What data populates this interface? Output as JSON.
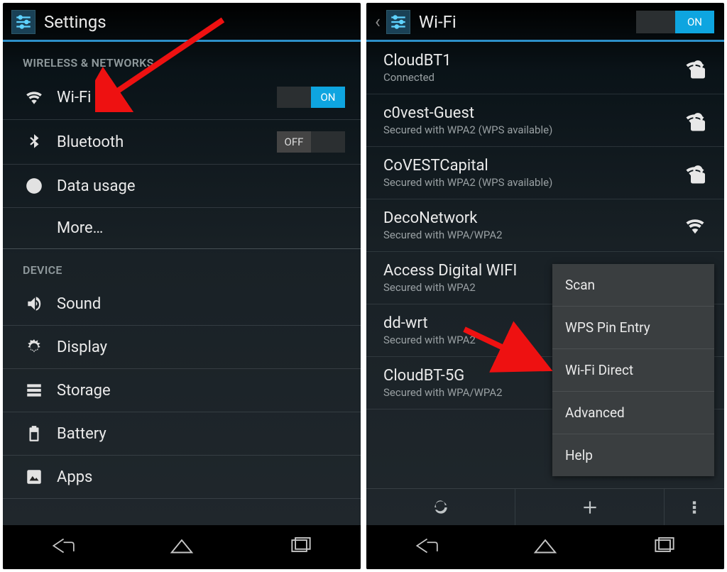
{
  "left": {
    "title": "Settings",
    "sections": {
      "wireless_label": "WIRELESS & NETWORKS",
      "device_label": "DEVICE"
    },
    "rows": {
      "wifi": {
        "label": "Wi-Fi",
        "toggle_on": "ON"
      },
      "bluetooth": {
        "label": "Bluetooth",
        "toggle_off": "OFF"
      },
      "data_usage": {
        "label": "Data usage"
      },
      "more": {
        "label": "More…"
      },
      "sound": {
        "label": "Sound"
      },
      "display": {
        "label": "Display"
      },
      "storage": {
        "label": "Storage"
      },
      "battery": {
        "label": "Battery"
      },
      "apps": {
        "label": "Apps"
      }
    }
  },
  "right": {
    "title": "Wi-Fi",
    "toggle_on": "ON",
    "networks": [
      {
        "ssid": "CloudBT1",
        "sub": "Connected",
        "secured": true
      },
      {
        "ssid": "c0vest-Guest",
        "sub": "Secured with WPA2 (WPS available)",
        "secured": true
      },
      {
        "ssid": "CoVESTCapital",
        "sub": "Secured with WPA2 (WPS available)",
        "secured": true
      },
      {
        "ssid": "DecoNetwork",
        "sub": "Secured with WPA/WPA2",
        "secured": true
      },
      {
        "ssid": "Access Digital WIFI",
        "sub": "Secured with WPA2",
        "secured": true
      },
      {
        "ssid": "dd-wrt",
        "sub": "Secured with WPA2",
        "secured": true
      },
      {
        "ssid": "CloudBT-5G",
        "sub": "Secured with WPA/WPA2",
        "secured": true
      }
    ],
    "menu": {
      "scan": "Scan",
      "wps": "WPS Pin Entry",
      "direct": "Wi-Fi Direct",
      "advanced": "Advanced",
      "help": "Help"
    }
  }
}
